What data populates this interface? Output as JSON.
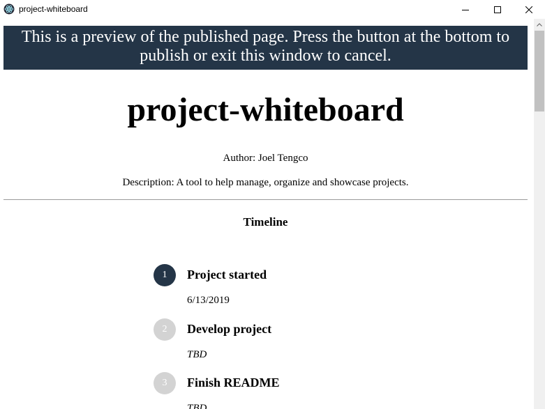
{
  "window": {
    "title": "project-whiteboard",
    "app_icon": "electron-atom-icon",
    "controls": [
      "minimize-icon",
      "maximize-icon",
      "close-icon"
    ]
  },
  "banner": {
    "text": "This is a preview of the published page. Press the button at the bottom to publish or exit this window to cancel.",
    "color": "#243547"
  },
  "page": {
    "title": "project-whiteboard",
    "author": "Author: Joel Tengco",
    "description": "Description: A tool to help manage, organize and showcase projects."
  },
  "timeline": {
    "heading": "Timeline",
    "steps": [
      {
        "number": "1",
        "title": "Project started",
        "date": "6/13/2019",
        "status": "complete"
      },
      {
        "number": "2",
        "title": "Develop project",
        "date": "TBD",
        "status": "pending"
      },
      {
        "number": "3",
        "title": "Finish README",
        "date": "TBD",
        "status": "pending"
      }
    ]
  }
}
